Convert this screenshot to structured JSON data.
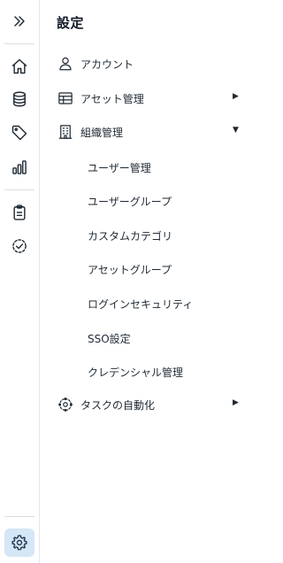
{
  "rail": {
    "top_icon": "chevrons-right-icon",
    "items": [
      {
        "icon": "home-icon"
      },
      {
        "icon": "database-icon"
      },
      {
        "icon": "tag-icon"
      },
      {
        "icon": "bar-chart-icon"
      },
      {
        "icon": "clipboard-icon"
      },
      {
        "icon": "check-circle-icon"
      }
    ],
    "bottom_icon": "gear-icon",
    "active_color": "#d5e6f7"
  },
  "settings_menu": {
    "title": "設定",
    "items": [
      {
        "label": "アカウント",
        "icon": "user-icon",
        "expandable": false
      },
      {
        "label": "アセット管理",
        "icon": "table-icon",
        "expandable": true,
        "arrow": "▶"
      },
      {
        "label": "組織管理",
        "icon": "building-icon",
        "expandable": true,
        "arrow": "▼",
        "children": [
          {
            "label": "ユーザー管理"
          },
          {
            "label": "ユーザーグループ"
          },
          {
            "label": "カスタムカテゴリ"
          },
          {
            "label": "アセットグループ"
          },
          {
            "label": "ログインセキュリティ"
          },
          {
            "label": "SSO設定"
          },
          {
            "label": "クレデンシャル管理"
          }
        ]
      },
      {
        "label": "タスクの自動化",
        "icon": "automation-icon",
        "expandable": true,
        "arrow": "▶"
      }
    ]
  }
}
